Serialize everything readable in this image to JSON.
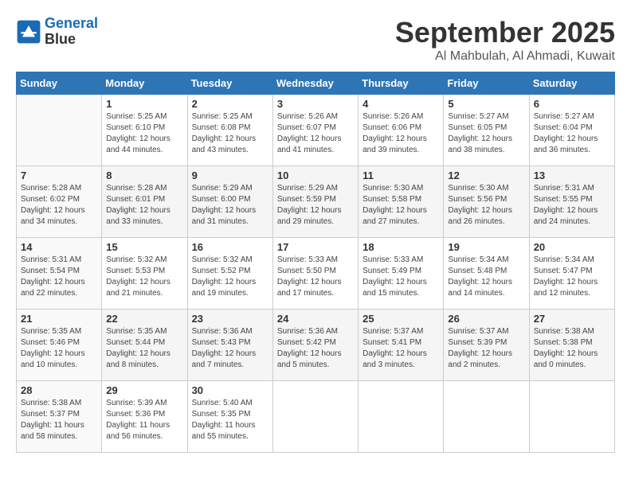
{
  "header": {
    "logo_line1": "General",
    "logo_line2": "Blue",
    "month": "September 2025",
    "location": "Al Mahbulah, Al Ahmadi, Kuwait"
  },
  "weekdays": [
    "Sunday",
    "Monday",
    "Tuesday",
    "Wednesday",
    "Thursday",
    "Friday",
    "Saturday"
  ],
  "weeks": [
    [
      {
        "day": "",
        "sunrise": "",
        "sunset": "",
        "daylight": ""
      },
      {
        "day": "1",
        "sunrise": "Sunrise: 5:25 AM",
        "sunset": "Sunset: 6:10 PM",
        "daylight": "Daylight: 12 hours and 44 minutes."
      },
      {
        "day": "2",
        "sunrise": "Sunrise: 5:25 AM",
        "sunset": "Sunset: 6:08 PM",
        "daylight": "Daylight: 12 hours and 43 minutes."
      },
      {
        "day": "3",
        "sunrise": "Sunrise: 5:26 AM",
        "sunset": "Sunset: 6:07 PM",
        "daylight": "Daylight: 12 hours and 41 minutes."
      },
      {
        "day": "4",
        "sunrise": "Sunrise: 5:26 AM",
        "sunset": "Sunset: 6:06 PM",
        "daylight": "Daylight: 12 hours and 39 minutes."
      },
      {
        "day": "5",
        "sunrise": "Sunrise: 5:27 AM",
        "sunset": "Sunset: 6:05 PM",
        "daylight": "Daylight: 12 hours and 38 minutes."
      },
      {
        "day": "6",
        "sunrise": "Sunrise: 5:27 AM",
        "sunset": "Sunset: 6:04 PM",
        "daylight": "Daylight: 12 hours and 36 minutes."
      }
    ],
    [
      {
        "day": "7",
        "sunrise": "Sunrise: 5:28 AM",
        "sunset": "Sunset: 6:02 PM",
        "daylight": "Daylight: 12 hours and 34 minutes."
      },
      {
        "day": "8",
        "sunrise": "Sunrise: 5:28 AM",
        "sunset": "Sunset: 6:01 PM",
        "daylight": "Daylight: 12 hours and 33 minutes."
      },
      {
        "day": "9",
        "sunrise": "Sunrise: 5:29 AM",
        "sunset": "Sunset: 6:00 PM",
        "daylight": "Daylight: 12 hours and 31 minutes."
      },
      {
        "day": "10",
        "sunrise": "Sunrise: 5:29 AM",
        "sunset": "Sunset: 5:59 PM",
        "daylight": "Daylight: 12 hours and 29 minutes."
      },
      {
        "day": "11",
        "sunrise": "Sunrise: 5:30 AM",
        "sunset": "Sunset: 5:58 PM",
        "daylight": "Daylight: 12 hours and 27 minutes."
      },
      {
        "day": "12",
        "sunrise": "Sunrise: 5:30 AM",
        "sunset": "Sunset: 5:56 PM",
        "daylight": "Daylight: 12 hours and 26 minutes."
      },
      {
        "day": "13",
        "sunrise": "Sunrise: 5:31 AM",
        "sunset": "Sunset: 5:55 PM",
        "daylight": "Daylight: 12 hours and 24 minutes."
      }
    ],
    [
      {
        "day": "14",
        "sunrise": "Sunrise: 5:31 AM",
        "sunset": "Sunset: 5:54 PM",
        "daylight": "Daylight: 12 hours and 22 minutes."
      },
      {
        "day": "15",
        "sunrise": "Sunrise: 5:32 AM",
        "sunset": "Sunset: 5:53 PM",
        "daylight": "Daylight: 12 hours and 21 minutes."
      },
      {
        "day": "16",
        "sunrise": "Sunrise: 5:32 AM",
        "sunset": "Sunset: 5:52 PM",
        "daylight": "Daylight: 12 hours and 19 minutes."
      },
      {
        "day": "17",
        "sunrise": "Sunrise: 5:33 AM",
        "sunset": "Sunset: 5:50 PM",
        "daylight": "Daylight: 12 hours and 17 minutes."
      },
      {
        "day": "18",
        "sunrise": "Sunrise: 5:33 AM",
        "sunset": "Sunset: 5:49 PM",
        "daylight": "Daylight: 12 hours and 15 minutes."
      },
      {
        "day": "19",
        "sunrise": "Sunrise: 5:34 AM",
        "sunset": "Sunset: 5:48 PM",
        "daylight": "Daylight: 12 hours and 14 minutes."
      },
      {
        "day": "20",
        "sunrise": "Sunrise: 5:34 AM",
        "sunset": "Sunset: 5:47 PM",
        "daylight": "Daylight: 12 hours and 12 minutes."
      }
    ],
    [
      {
        "day": "21",
        "sunrise": "Sunrise: 5:35 AM",
        "sunset": "Sunset: 5:46 PM",
        "daylight": "Daylight: 12 hours and 10 minutes."
      },
      {
        "day": "22",
        "sunrise": "Sunrise: 5:35 AM",
        "sunset": "Sunset: 5:44 PM",
        "daylight": "Daylight: 12 hours and 8 minutes."
      },
      {
        "day": "23",
        "sunrise": "Sunrise: 5:36 AM",
        "sunset": "Sunset: 5:43 PM",
        "daylight": "Daylight: 12 hours and 7 minutes."
      },
      {
        "day": "24",
        "sunrise": "Sunrise: 5:36 AM",
        "sunset": "Sunset: 5:42 PM",
        "daylight": "Daylight: 12 hours and 5 minutes."
      },
      {
        "day": "25",
        "sunrise": "Sunrise: 5:37 AM",
        "sunset": "Sunset: 5:41 PM",
        "daylight": "Daylight: 12 hours and 3 minutes."
      },
      {
        "day": "26",
        "sunrise": "Sunrise: 5:37 AM",
        "sunset": "Sunset: 5:39 PM",
        "daylight": "Daylight: 12 hours and 2 minutes."
      },
      {
        "day": "27",
        "sunrise": "Sunrise: 5:38 AM",
        "sunset": "Sunset: 5:38 PM",
        "daylight": "Daylight: 12 hours and 0 minutes."
      }
    ],
    [
      {
        "day": "28",
        "sunrise": "Sunrise: 5:38 AM",
        "sunset": "Sunset: 5:37 PM",
        "daylight": "Daylight: 11 hours and 58 minutes."
      },
      {
        "day": "29",
        "sunrise": "Sunrise: 5:39 AM",
        "sunset": "Sunset: 5:36 PM",
        "daylight": "Daylight: 11 hours and 56 minutes."
      },
      {
        "day": "30",
        "sunrise": "Sunrise: 5:40 AM",
        "sunset": "Sunset: 5:35 PM",
        "daylight": "Daylight: 11 hours and 55 minutes."
      },
      {
        "day": "",
        "sunrise": "",
        "sunset": "",
        "daylight": ""
      },
      {
        "day": "",
        "sunrise": "",
        "sunset": "",
        "daylight": ""
      },
      {
        "day": "",
        "sunrise": "",
        "sunset": "",
        "daylight": ""
      },
      {
        "day": "",
        "sunrise": "",
        "sunset": "",
        "daylight": ""
      }
    ]
  ]
}
